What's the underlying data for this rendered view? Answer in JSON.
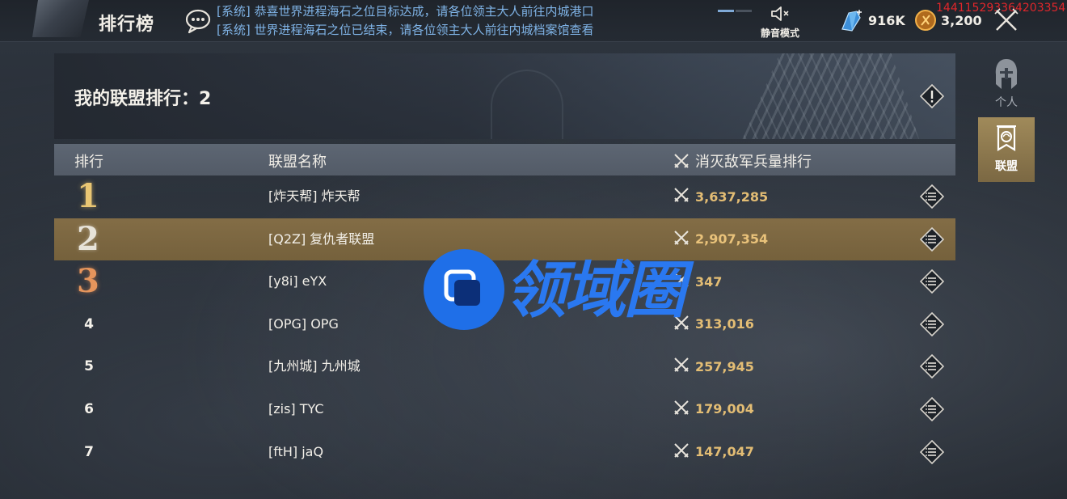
{
  "header": {
    "title": "排行榜",
    "announcements": [
      "[系统] 恭喜世界进程海石之位目标达成，请各位领主大人前往内城港口",
      "[系统] 世界进程海石之位已结束，请各位领主大人前往内城档案馆查看"
    ],
    "mute_label": "静音模式",
    "resources": {
      "gems": "916K",
      "coins": "3,200"
    },
    "debug_id": "1441152933642033541"
  },
  "side_tabs": [
    {
      "label": "个人",
      "active": false,
      "icon": "helmet-icon"
    },
    {
      "label": "联盟",
      "active": true,
      "icon": "alliance-banner-icon"
    }
  ],
  "panel": {
    "my_rank_label": "我的联盟排行：",
    "my_rank_value": "2",
    "columns": {
      "rank": "排行",
      "name": "联盟名称",
      "kills": "消灭敌军兵量排行"
    },
    "rows": [
      {
        "rank": "1",
        "name": "[炸天帮] 炸天帮",
        "kills": "3,637,285"
      },
      {
        "rank": "2",
        "name": "[Q2Z] 复仇者联盟",
        "kills": "2,907,354"
      },
      {
        "rank": "3",
        "name": "[y8i] eYX",
        "kills": "347"
      },
      {
        "rank": "4",
        "name": "[OPG] OPG",
        "kills": "313,016"
      },
      {
        "rank": "5",
        "name": "[九州城] 九州城",
        "kills": "257,945"
      },
      {
        "rank": "6",
        "name": "[zis] TYC",
        "kills": "179,004"
      },
      {
        "rank": "7",
        "name": "[ftH] jaQ",
        "kills": "147,047"
      }
    ],
    "highlight_rank": "2"
  },
  "watermark": {
    "text": "领域圈",
    "color": "#1f6fe8"
  },
  "colors": {
    "accent_gold": "#e3bd74",
    "highlight_row": "#836d46",
    "announce": "#7fb3e6"
  }
}
